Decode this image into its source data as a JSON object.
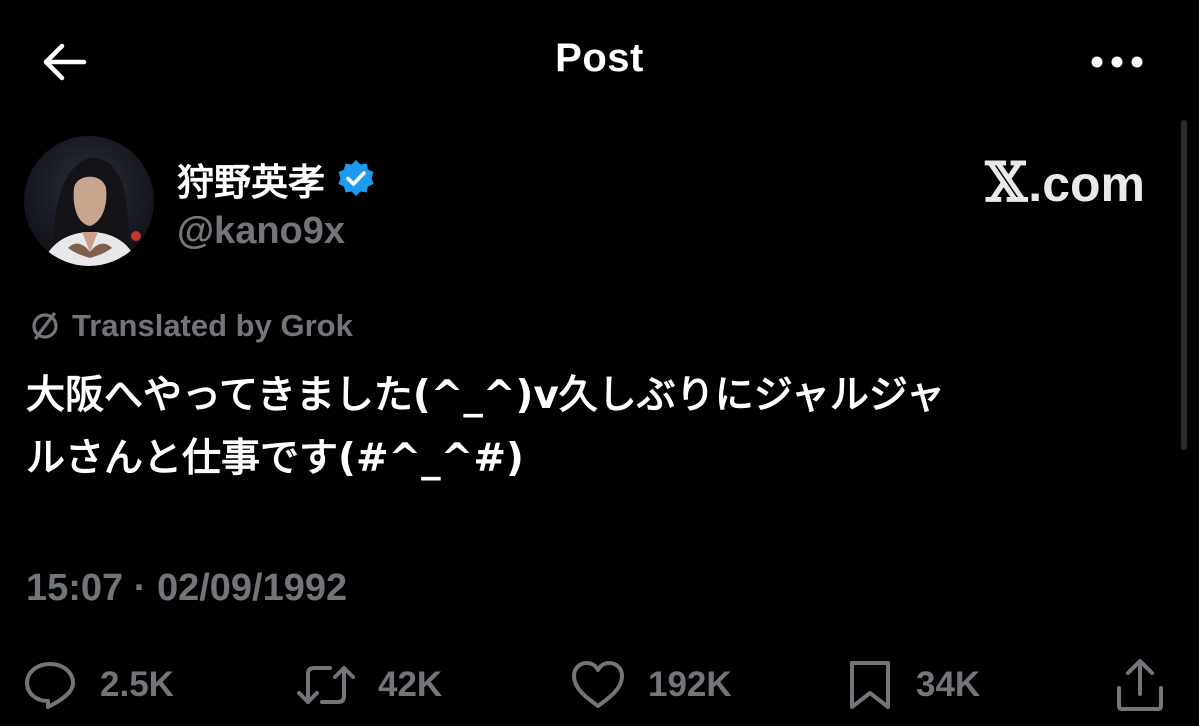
{
  "header": {
    "title": "Post"
  },
  "author": {
    "display_name": "狩野英孝",
    "handle": "@kano9x",
    "verified_color": "#1d9bf0"
  },
  "watermark": {
    "x_glyph": "𝕏",
    "text": ".com"
  },
  "translation": {
    "label": "Translated by Grok"
  },
  "post": {
    "text": "大阪へやってきました(^_^)v久しぶりにジャルジャルさんと仕事です(#^_^#)",
    "line1": "大阪へやってきました(^_^)v久しぶりにジャルジャ",
    "line2": "ルさんと仕事です(#^_^#)",
    "timestamp": "15:07 · 02/09/1992"
  },
  "actions": {
    "replies": "2.5K",
    "reposts": "42K",
    "likes": "192K",
    "bookmarks": "34K"
  },
  "colors": {
    "background": "#000000",
    "text": "#ffffff",
    "muted": "#71767b",
    "accent": "#1d9bf0"
  },
  "icons": [
    "back-arrow-icon",
    "more-icon",
    "verified-icon",
    "grok-icon",
    "reply-icon",
    "repost-icon",
    "like-icon",
    "bookmark-icon",
    "share-icon"
  ]
}
